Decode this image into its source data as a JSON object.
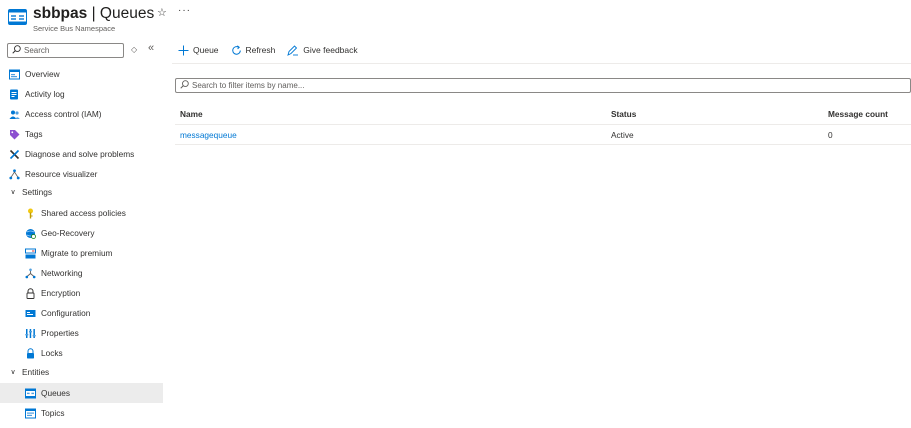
{
  "header": {
    "title_name": "sbbpas",
    "title_sep": " | ",
    "title_page": "Queues",
    "subtitle": "Service Bus Namespace",
    "star_icon": "star-icon",
    "more_icon": "more-icon"
  },
  "sidebar": {
    "search_placeholder": "Search",
    "items": [
      {
        "label": "Overview",
        "icon": "overview-icon"
      },
      {
        "label": "Activity log",
        "icon": "activity-log-icon"
      },
      {
        "label": "Access control (IAM)",
        "icon": "people-icon"
      },
      {
        "label": "Tags",
        "icon": "tag-icon"
      },
      {
        "label": "Diagnose and solve problems",
        "icon": "wrench-icon"
      },
      {
        "label": "Resource visualizer",
        "icon": "visualizer-icon"
      }
    ],
    "settings_group": {
      "label": "Settings",
      "items": [
        {
          "label": "Shared access policies",
          "icon": "key-icon"
        },
        {
          "label": "Geo-Recovery",
          "icon": "globe-icon"
        },
        {
          "label": "Migrate to premium",
          "icon": "migrate-icon"
        },
        {
          "label": "Networking",
          "icon": "network-icon"
        },
        {
          "label": "Encryption",
          "icon": "lock-icon"
        },
        {
          "label": "Configuration",
          "icon": "configuration-icon"
        },
        {
          "label": "Properties",
          "icon": "properties-icon"
        },
        {
          "label": "Locks",
          "icon": "lock-icon"
        }
      ]
    },
    "entities_group": {
      "label": "Entities",
      "items": [
        {
          "label": "Queues",
          "icon": "queue-icon",
          "selected": true
        },
        {
          "label": "Topics",
          "icon": "topic-icon"
        }
      ]
    }
  },
  "toolbar": {
    "add_queue": "Queue",
    "refresh": "Refresh",
    "feedback": "Give feedback"
  },
  "filter": {
    "placeholder": "Search to filter items by name..."
  },
  "table": {
    "columns": [
      "Name",
      "Status",
      "Message count"
    ],
    "rows": [
      {
        "name": "messagequeue",
        "status": "Active",
        "message_count": "0"
      }
    ]
  },
  "colors": {
    "accent": "#0078d4",
    "selected_bg": "#ececec",
    "border": "#8a8886"
  }
}
